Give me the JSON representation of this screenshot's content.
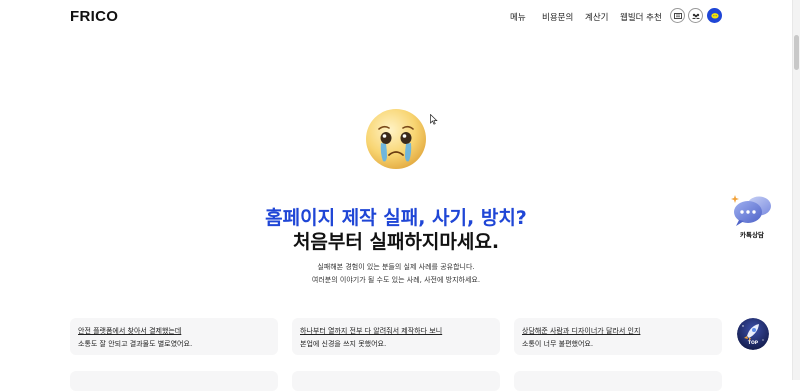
{
  "header": {
    "logo": "FRICO",
    "nav": [
      "메뉴",
      "비용문의",
      "계산기",
      "웹빌더 추천"
    ]
  },
  "hero": {
    "headline_blue": "홈페이지 제작 실패, 사기, 방치?",
    "headline_black": "처음부터 실패하지마세요.",
    "sub_lines": [
      "실패해본 경험이 있는 분들의 실제 사례를 공유합니다.",
      "여러분의 이야기가 될 수도 있는 사례, 사전에 방지하세요."
    ]
  },
  "cards": [
    {
      "title": "안전 플랫폼에서 찾아서 결제했는데",
      "desc": "소통도 잘 안되고 결과물도 별로였어요."
    },
    {
      "title": "하나부터 열까지 전부 다 알려줘서 제작하다 보니",
      "desc": "본업에 신경을 쓰지 못했어요."
    },
    {
      "title": "상담해준 사람과 디자이너가 달라서 인지",
      "desc": "소통이 너무 불편했어요."
    }
  ],
  "floating": {
    "kakao_label": "카톡상담",
    "top_label": "TOP"
  },
  "colors": {
    "accent_blue": "#1f46d6",
    "card_bg": "#f6f6f7"
  },
  "icons": [
    "menu-list-icon",
    "people-icon",
    "chat-icon",
    "crying-emoji-icon",
    "chat-bubbles-icon",
    "rocket-icon"
  ]
}
